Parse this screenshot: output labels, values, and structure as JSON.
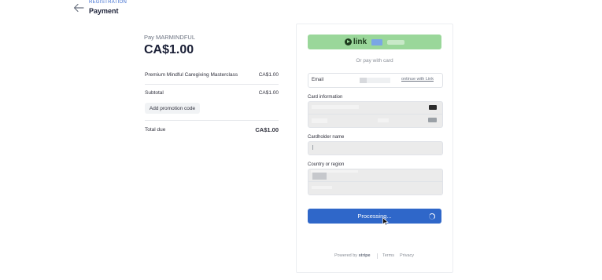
{
  "header": {
    "breadcrumb": "REGISTRATION",
    "title": "Payment"
  },
  "summary": {
    "pay_to": "Pay MARMINDFUL",
    "amount": "CA$1.00",
    "items": [
      {
        "label": "Premium Mindful Caregiving Masterclass",
        "value": "CA$1.00"
      }
    ],
    "subtotal_label": "Subtotal",
    "subtotal_value": "CA$1.00",
    "promo_label": "Add promotion code",
    "total_label": "Total due",
    "total_value": "CA$1.00"
  },
  "payment": {
    "link_label": "link",
    "or_pay": "Or pay with card",
    "email_label": "Email",
    "continue_link": "ontinue with Link",
    "card_label": "Card information",
    "cardholder_label": "Cardholder name",
    "country_label": "Country or region",
    "pay_button": "Processing...",
    "accent_color": "#2f67c9",
    "link_color": "#9ad79a"
  },
  "footer": {
    "powered_by": "Powered by",
    "brand": "stripe",
    "terms": "Terms",
    "privacy": "Privacy"
  }
}
